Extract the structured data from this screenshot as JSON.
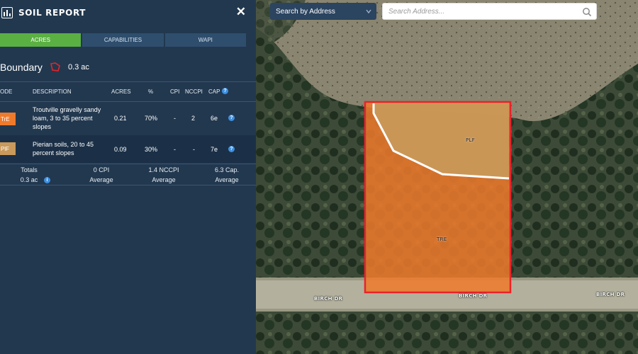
{
  "panel": {
    "title": "SOIL REPORT",
    "close_icon": "close-icon",
    "tabs": [
      {
        "label": "ACRES",
        "active": true
      },
      {
        "label": "CAPABILITIES",
        "active": false
      },
      {
        "label": "WAPI",
        "active": false
      }
    ],
    "boundary": {
      "label": "Boundary",
      "area": "0.3 ac",
      "boundary_color": "#e8232a"
    },
    "columns": {
      "code": "ODE",
      "description": "DESCRIPTION",
      "acres": "ACRES",
      "percent": "%",
      "cpi": "CPI",
      "nccpi": "NCCPI",
      "cap": "CAP"
    },
    "rows": [
      {
        "code": "TrE",
        "code_color": "#f07a2c",
        "description": "Troutville gravelly sandy loam, 3 to 35 percent slopes",
        "acres": "0.21",
        "percent": "70%",
        "cpi": "-",
        "nccpi": "2",
        "cap": "6e"
      },
      {
        "code": "PlF",
        "code_color": "#c99a5b",
        "description": "Pierian soils, 20 to 45 percent slopes",
        "acres": "0.09",
        "percent": "30%",
        "cpi": "-",
        "nccpi": "-",
        "cap": "7e"
      }
    ],
    "totals": {
      "label": "Totals",
      "acres": "0.3 ac",
      "cpi_value": "0 CPI",
      "cpi_label": "Average",
      "nccpi_value": "1.4 NCCPI",
      "nccpi_label": "Average",
      "cap_value": "6.3 Cap.",
      "cap_label": "Average"
    }
  },
  "map": {
    "search_type": "Search by Address",
    "search_placeholder": "Search Address...",
    "polygon_labels": {
      "plf": "PLF",
      "tre": "TRE"
    },
    "road_labels": [
      "BIRCH DR",
      "BIRCH DR",
      "BIRCH DR"
    ],
    "colors": {
      "tre_fill": "#f07a2c",
      "plf_fill": "#c99a5b",
      "boundary": "#e8232a"
    }
  }
}
